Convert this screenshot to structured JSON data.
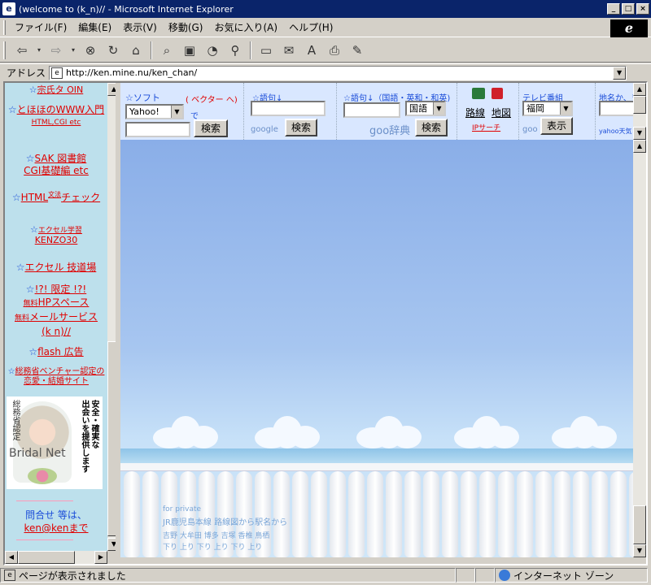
{
  "window": {
    "title": "(welcome to (k_n)// - Microsoft Internet Explorer",
    "min": "_",
    "max": "□",
    "close": "×"
  },
  "menu": [
    "ファイル(F)",
    "編集(E)",
    "表示(V)",
    "移動(G)",
    "お気に入り(A)",
    "ヘルプ(H)"
  ],
  "toolbar": {
    "back": "⇦",
    "forward": "⇨",
    "stop": "⊗",
    "refresh": "↻",
    "home": "⌂",
    "search": "⌕",
    "favorites": "▣",
    "history": "◔",
    "channels": "⚲",
    "fullscreen": "▭",
    "mail": "✉",
    "fonts": "A",
    "print": "⎙",
    "edit": "✎"
  },
  "address": {
    "label": "アドレス",
    "url": "http://ken.mine.nu/ken_chan/"
  },
  "sidebar": {
    "items": [
      {
        "star": "☆",
        "text": "宗氏タ OIN"
      },
      {
        "star": "☆",
        "text": "とほほのWWW入門",
        "sub": "HTML,CGI etc"
      },
      {
        "star": "☆",
        "text": "SAK 図書館",
        "sub": "CGI基礎編 etc"
      },
      {
        "star": "☆",
        "text": "HTML",
        "sup": "文法",
        "text2": "チェック"
      },
      {
        "star": "☆",
        "small": "エクセル学習",
        "text": "KENZO30"
      },
      {
        "star": "☆",
        "text": "エクセル 技道場"
      },
      {
        "star": "☆",
        "text": "!?! 限定 !?!",
        "badge": "無料",
        "text2": "HPスペース",
        "text3": "メールサービス",
        "text4": "(k n)//"
      },
      {
        "star": "☆",
        "text": "flash 広告"
      },
      {
        "star": "☆",
        "small": "総務省ベンチャー認定の",
        "text": "恋愛・結婚サイト"
      }
    ],
    "banner": {
      "v1": "総務省認定",
      "v2": "安全・確実な",
      "v3": "出会いを提供します",
      "brand": "Bridal Net"
    },
    "contact": {
      "label": "問合せ 等は、",
      "link": "ken@kenまで"
    }
  },
  "search": {
    "soft": {
      "label": "☆ソフト",
      "link": "( ベクター へ)",
      "engine": "Yahoo!",
      "de": "で",
      "button": "検索"
    },
    "google": {
      "label": "☆語句↓",
      "logo": "google",
      "button": "検索"
    },
    "dict": {
      "label": "☆語句↓（国語・英和・和英)",
      "select": "国語",
      "logo": "goo辞典",
      "button": "検索"
    },
    "route": {
      "route": "路線",
      "map": "地図",
      "ip": "IPサーチ"
    },
    "tv": {
      "label": "テレビ番組",
      "select": "福岡",
      "logo": "goo",
      "button": "表示"
    },
    "weather": {
      "label": "地名か、〒↓",
      "logo": "yahoo天気"
    }
  },
  "content": {
    "footer": {
      "l1": "for private",
      "l2": "JR鹿児島本線 路線図から駅名から",
      "l3": "吉野  大牟田  博多  吉塚  香椎  鳥栖",
      "l4": "下り  上り  下り  上り  下り  上り"
    }
  },
  "status": {
    "text": "ページが表示されました",
    "zone": "インターネット ゾーン"
  }
}
